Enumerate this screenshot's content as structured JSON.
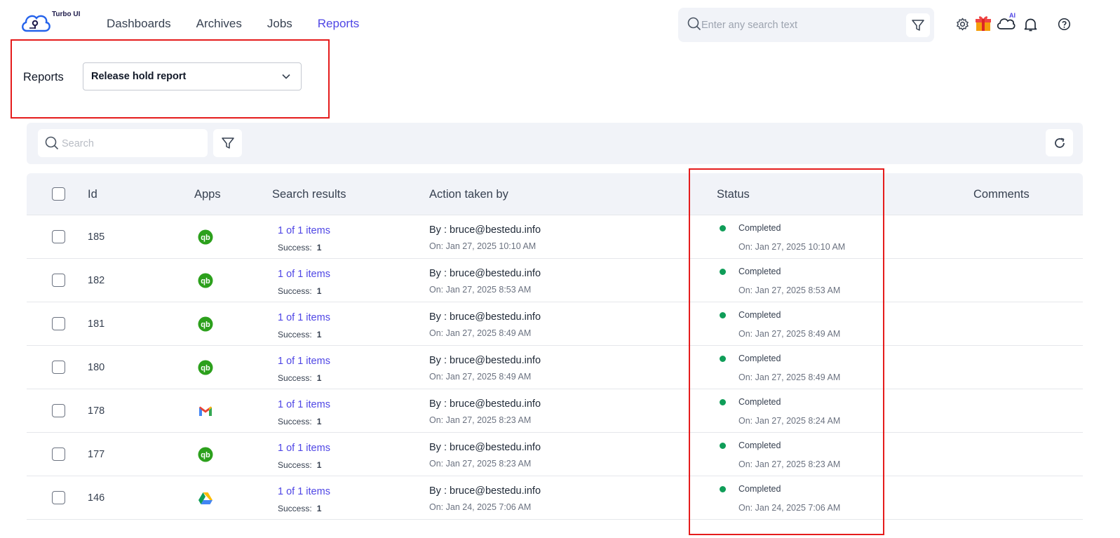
{
  "app": {
    "logo_text": "Turbo UI"
  },
  "nav": {
    "items": [
      {
        "label": "Dashboards",
        "active": false
      },
      {
        "label": "Archives",
        "active": false
      },
      {
        "label": "Jobs",
        "active": false
      },
      {
        "label": "Reports",
        "active": true
      }
    ]
  },
  "header": {
    "search_placeholder": "Enter any search text",
    "ai_badge": "AI",
    "icons": [
      "settings-icon",
      "gift-icon",
      "ai-cloud-icon",
      "bell-icon",
      "help-icon"
    ]
  },
  "reports": {
    "label": "Reports",
    "selected": "Release hold report"
  },
  "toolbar": {
    "search_placeholder": "Search"
  },
  "table": {
    "columns": [
      "Id",
      "Apps",
      "Search results",
      "Action taken by",
      "Status",
      "Comments"
    ],
    "success_label": "Success:",
    "rows": [
      {
        "id": "185",
        "app": "quickbooks",
        "results": "1 of 1 items",
        "success": "1",
        "by": "By : bruce@bestedu.info",
        "on": "On: Jan 27, 2025 10:10 AM",
        "status": "Completed",
        "status_on": "On: Jan 27, 2025 10:10 AM"
      },
      {
        "id": "182",
        "app": "quickbooks",
        "results": "1 of 1 items",
        "success": "1",
        "by": "By : bruce@bestedu.info",
        "on": "On: Jan 27, 2025 8:53 AM",
        "status": "Completed",
        "status_on": "On: Jan 27, 2025 8:53 AM"
      },
      {
        "id": "181",
        "app": "quickbooks",
        "results": "1 of 1 items",
        "success": "1",
        "by": "By : bruce@bestedu.info",
        "on": "On: Jan 27, 2025 8:49 AM",
        "status": "Completed",
        "status_on": "On: Jan 27, 2025 8:49 AM"
      },
      {
        "id": "180",
        "app": "quickbooks",
        "results": "1 of 1 items",
        "success": "1",
        "by": "By : bruce@bestedu.info",
        "on": "On: Jan 27, 2025 8:49 AM",
        "status": "Completed",
        "status_on": "On: Jan 27, 2025 8:49 AM"
      },
      {
        "id": "178",
        "app": "gmail",
        "results": "1 of 1 items",
        "success": "1",
        "by": "By : bruce@bestedu.info",
        "on": "On: Jan 27, 2025 8:23 AM",
        "status": "Completed",
        "status_on": "On: Jan 27, 2025 8:24 AM"
      },
      {
        "id": "177",
        "app": "quickbooks",
        "results": "1 of 1 items",
        "success": "1",
        "by": "By : bruce@bestedu.info",
        "on": "On: Jan 27, 2025 8:23 AM",
        "status": "Completed",
        "status_on": "On: Jan 27, 2025 8:23 AM"
      },
      {
        "id": "146",
        "app": "google-drive",
        "results": "1 of 1 items",
        "success": "1",
        "by": "By : bruce@bestedu.info",
        "on": "On: Jan 24, 2025 7:06 AM",
        "status": "Completed",
        "status_on": "On: Jan 24, 2025 7:06 AM"
      }
    ]
  },
  "colors": {
    "accent": "#4f46e5",
    "status_completed": "#0f9d58",
    "highlight": "#e51c1c",
    "quickbooks": "#2ca01c"
  }
}
